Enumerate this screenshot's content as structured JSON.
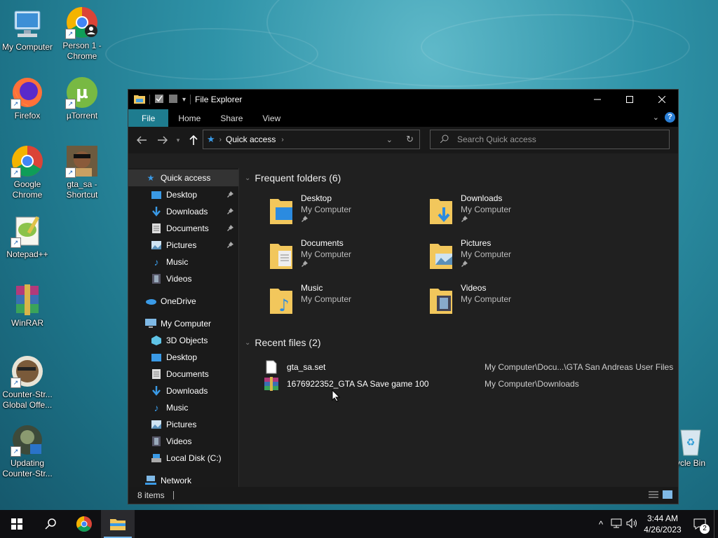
{
  "desktop": {
    "icons": [
      {
        "label": "My Computer"
      },
      {
        "label": "Person 1 - Chrome"
      },
      {
        "label": "Firefox"
      },
      {
        "label": "µTorrent"
      },
      {
        "label": "Google Chrome"
      },
      {
        "label": "gta_sa - Shortcut"
      },
      {
        "label": "Notepad++"
      },
      {
        "label": "WinRAR"
      },
      {
        "label": "Counter-Str... Global Offe..."
      },
      {
        "label": "Updating Counter-Str..."
      },
      {
        "label": "ycle Bin"
      }
    ]
  },
  "explorer": {
    "title": "File Explorer",
    "ribbon_tabs": [
      "File",
      "Home",
      "Share",
      "View"
    ],
    "address": {
      "crumb": "Quick access"
    },
    "search": {
      "placeholder": "Search Quick access"
    },
    "sidebar": [
      {
        "label": "Quick access"
      },
      {
        "label": "Desktop"
      },
      {
        "label": "Downloads"
      },
      {
        "label": "Documents"
      },
      {
        "label": "Pictures"
      },
      {
        "label": "Music"
      },
      {
        "label": "Videos"
      },
      {
        "label": "OneDrive"
      },
      {
        "label": "My Computer"
      },
      {
        "label": "3D Objects"
      },
      {
        "label": "Desktop"
      },
      {
        "label": "Documents"
      },
      {
        "label": "Downloads"
      },
      {
        "label": "Music"
      },
      {
        "label": "Pictures"
      },
      {
        "label": "Videos"
      },
      {
        "label": "Local Disk (C:)"
      },
      {
        "label": "Network"
      }
    ],
    "frequent_header": "Frequent folders (6)",
    "frequent": [
      {
        "name": "Desktop",
        "location": "My Computer"
      },
      {
        "name": "Downloads",
        "location": "My Computer"
      },
      {
        "name": "Documents",
        "location": "My Computer"
      },
      {
        "name": "Pictures",
        "location": "My Computer"
      },
      {
        "name": "Music",
        "location": "My Computer"
      },
      {
        "name": "Videos",
        "location": "My Computer"
      }
    ],
    "recent_header": "Recent files (2)",
    "recent": [
      {
        "name": "gta_sa.set",
        "path": "My Computer\\Docu...\\GTA San Andreas User Files"
      },
      {
        "name": "1676922352_GTA SA Save game 100",
        "path": "My Computer\\Downloads"
      }
    ],
    "status": {
      "items": "8 items"
    }
  },
  "taskbar": {
    "time": "3:44 AM",
    "date": "4/26/2023",
    "notifications": "2"
  },
  "colors": {
    "accent": "#1e7c8f",
    "window_bg": "#202020",
    "folder": "#f2c75c"
  }
}
